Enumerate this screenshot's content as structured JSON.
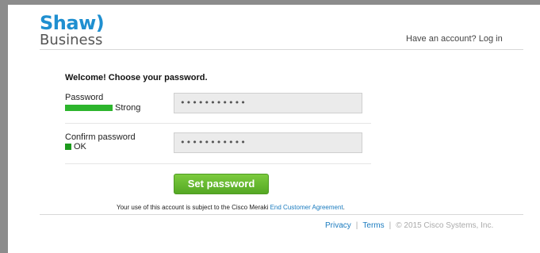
{
  "header": {
    "logo_line1": "Shaw)",
    "logo_line2": "Business",
    "login_link": "Have an account? Log in"
  },
  "form": {
    "title": "Welcome! Choose your password.",
    "password": {
      "label": "Password",
      "strength_text": "Strong",
      "strength_color": "#2db52d",
      "value_masked": "•••••••••••"
    },
    "confirm": {
      "label": "Confirm password",
      "status_text": "OK",
      "status_color": "#1c9a1c",
      "value_masked": "•••••••••••"
    },
    "submit_label": "Set password",
    "terms_prefix": "Your use of this account is subject to the Cisco Meraki",
    "terms_link": "End Customer Agreement",
    "terms_suffix": "."
  },
  "footer": {
    "privacy": "Privacy",
    "separator": "|",
    "terms": "Terms",
    "copyright": "© 2015 Cisco Systems, Inc."
  },
  "colors": {
    "brand_blue": "#1f8fd0",
    "button_green": "#6ab833",
    "link_blue": "#1a7bbf"
  }
}
